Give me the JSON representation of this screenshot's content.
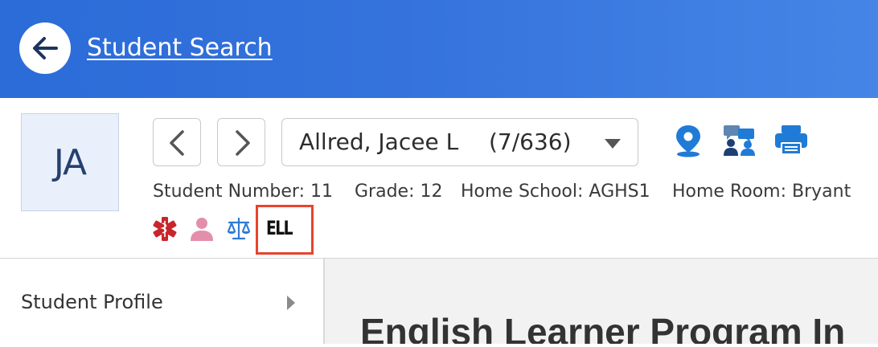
{
  "topbar": {
    "back_icon": "arrow-left-icon",
    "link_label": "Student Search",
    "background": "#2f6fd9"
  },
  "student": {
    "initials": "JA",
    "name": "Allred, Jacee L",
    "position": "(7/636)",
    "student_number_label": "Student Number: 11",
    "grade_label": "Grade: 12",
    "home_school_label": "Home School: AGHS1",
    "home_room_label": "Home Room: Bryant"
  },
  "nav": {
    "prev_icon": "chevron-left-icon",
    "next_icon": "chevron-right-icon",
    "select_caret_icon": "caret-down-icon"
  },
  "header_icons": [
    "map-pin-icon",
    "conference-icon",
    "printer-icon"
  ],
  "flags": {
    "icons": [
      "medical-alert-icon",
      "person-icon",
      "legal-scale-icon"
    ],
    "ell_label": "ELL",
    "highlight_color": "#e8432c"
  },
  "sidebar": {
    "items": [
      {
        "label": "Student Profile",
        "icon": "chevron-right-icon"
      }
    ]
  },
  "main": {
    "title": "English Learner Program In"
  },
  "colors": {
    "accent": "#1f7bd6",
    "medical": "#c8262b",
    "person": "#e38fac"
  }
}
